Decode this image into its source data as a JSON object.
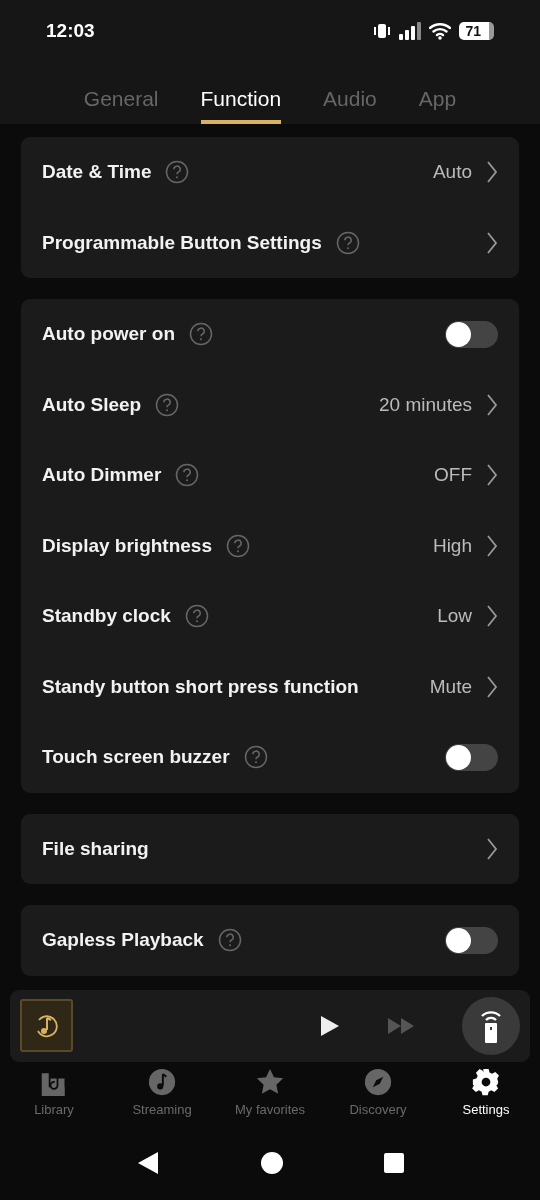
{
  "status_bar": {
    "time": "12:03",
    "battery": "71"
  },
  "tabs": [
    {
      "label": "General",
      "selected": false
    },
    {
      "label": "Function",
      "selected": true
    },
    {
      "label": "Audio",
      "selected": false
    },
    {
      "label": "App",
      "selected": false
    }
  ],
  "groups": [
    {
      "rows": [
        {
          "kind": "link",
          "label": "Date & Time",
          "help": true,
          "value": "Auto"
        },
        {
          "kind": "link",
          "label": "Programmable Button Settings",
          "help": true
        }
      ]
    },
    {
      "rows": [
        {
          "kind": "toggle",
          "label": "Auto power on",
          "help": true,
          "on": false
        },
        {
          "kind": "link",
          "label": "Auto Sleep",
          "help": true,
          "value": "20 minutes"
        },
        {
          "kind": "link",
          "label": "Auto Dimmer",
          "help": true,
          "value": "OFF"
        },
        {
          "kind": "link",
          "label": "Display brightness",
          "help": true,
          "value": "High"
        },
        {
          "kind": "link",
          "label": "Standby clock",
          "help": true,
          "value": "Low"
        },
        {
          "kind": "link",
          "label": "Standy button short press function",
          "help": false,
          "value": "Mute"
        },
        {
          "kind": "toggle",
          "label": "Touch screen buzzer",
          "help": true,
          "on": false
        }
      ]
    },
    {
      "rows": [
        {
          "kind": "link",
          "label": "File sharing",
          "help": false
        }
      ]
    },
    {
      "rows": [
        {
          "kind": "toggle",
          "label": "Gapless Playback",
          "help": true,
          "on": false
        }
      ]
    }
  ],
  "nav": [
    {
      "kind": "library",
      "label": "Library",
      "selected": false
    },
    {
      "kind": "streaming",
      "label": "Streaming",
      "selected": false
    },
    {
      "kind": "favorites",
      "label": "My favorites",
      "selected": false
    },
    {
      "kind": "discovery",
      "label": "Discovery",
      "selected": false
    },
    {
      "kind": "settings",
      "label": "Settings",
      "selected": true
    }
  ]
}
